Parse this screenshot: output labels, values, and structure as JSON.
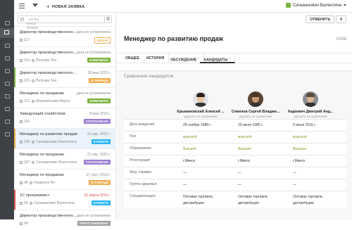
{
  "topbar": {
    "new_request": "НОВАЯ ЗАЯВКА",
    "user": "Сильванович Валентина"
  },
  "search": {
    "placeholder": "Быстрый поиск заявки"
  },
  "requests": [
    {
      "title": "Директор производственного...",
      "date": "дата не установлена",
      "num": "117",
      "person": "",
      "badge": "НОВАЯ",
      "badge_color": "outline",
      "bar": "",
      "date_red": false
    },
    {
      "title": "Директор производственного...",
      "date": "дата не установлена",
      "num": "116",
      "person": "Петрова Зоя",
      "badge": "ЗАВЕРШЕНА",
      "badge_color": "#7cb342",
      "bar": "",
      "date_red": false
    },
    {
      "title": "Директор производственного...",
      "date": "28 мая 2015 г.",
      "num": "115",
      "person": "Петрова Зоя",
      "badge": "В ОЧЕРЕДИ",
      "badge_color": "#f0ad4e",
      "bar": "#7cb342",
      "date_red": false
    },
    {
      "title": "Менеджер по продажам",
      "date": "дата не установлена",
      "num": "113",
      "person": "Шереметьева Марта",
      "badge": "ЗАВЕРШЕНА",
      "badge_color": "#7cb342",
      "bar": "",
      "date_red": false
    },
    {
      "title": "Заведующий хозяйством",
      "date": "8 мая 2015 г.",
      "num": "110",
      "person": "",
      "badge": "СОГЛАСОВАНА",
      "badge_color": "#9b7fd1",
      "bar": "",
      "date_red": false
    },
    {
      "title": "Менеджер по развитию продаж",
      "date": "21 апр. 2015 г.",
      "num": "108",
      "person": "Сильванович Валентина",
      "badge": "В РАБОТЕ",
      "badge_color": "#29b6f6",
      "bar": "#f0ad4e",
      "date_red": false
    },
    {
      "title": "Менеджер по продажам",
      "date": "21 апр. 2015 г.",
      "num": "107",
      "person": "Сильванович Валентина",
      "badge": "СОГЛАСОВАНА",
      "badge_color": "#9b7fd1",
      "bar": "",
      "date_red": false
    },
    {
      "title": "Менеджер по продажам",
      "date": "17 сент. 2013 г.",
      "num": "98",
      "person": "Азаренок Ян",
      "badge": "В ОЧЕРЕДИ",
      "badge_color": "#f0ad4e",
      "bar": "",
      "date_red": false
    },
    {
      "title": "1С программист",
      "date": "31 марта 2015 г.",
      "num": "96",
      "person": "Сильванович Валентина",
      "badge": "В РАБОТЕ",
      "badge_color": "#29b6f6",
      "bar": "#d9534f",
      "date_red": true
    },
    {
      "title": "Директор производственного...",
      "date": "дата не установлена",
      "num": "94",
      "person": "",
      "badge": "ПРИОСТАНОВЛЕНА",
      "badge_color": "#9e9e9e",
      "bar": "",
      "date_red": false
    }
  ],
  "detail": {
    "buttons": [
      "ОТМЕНИТЬ",
      "II"
    ],
    "title": "Менеджер по развитию продаж",
    "number": "#108",
    "tabs": [
      {
        "label": "ОБЩЕЕ",
        "count": ""
      },
      {
        "label": "ИСТОРИЯ",
        "count": ""
      },
      {
        "label": "ОБСУЖДЕНИЕ",
        "count": "2"
      },
      {
        "label": "КАНДИДАТЫ",
        "count": "5"
      }
    ],
    "compare_title": "Сравнение кандидатов",
    "candidates": [
      {
        "name": "Крыжановский Алексей ...",
        "status": "удалить из сравнения",
        "hair": "#2a1e16",
        "skin": "#e9c6a3",
        "bg": "#dfe3e6"
      },
      {
        "name": "Семенов Сергей Владим...",
        "status": "удалить из сравнения",
        "hair": "#4a3726",
        "skin": "#c99a72",
        "bg": "#5b4636"
      },
      {
        "name": "Хадкевич Дмитрий Анд...",
        "status": "удалить из сравнения",
        "hair": "#5a4a3a",
        "skin": "#dbb695",
        "bg": "#8a8d92"
      }
    ],
    "rows": [
      {
        "label": "Дата рождения",
        "values": [
          "28 ноября 1988 г.",
          "23 июля 1985 г.",
          "6 июня 2015 г."
        ],
        "link": false
      },
      {
        "label": "Пол",
        "values": [
          "мужской",
          "мужской",
          "мужской"
        ],
        "link": true
      },
      {
        "label": "Образование",
        "values": [
          "Высшее",
          "Высшее",
          "Высшее"
        ],
        "link": true
      },
      {
        "label": "Регистрация",
        "values": [
          "г.Минск",
          "г.Минск",
          "г.Минск"
        ],
        "link": false
      },
      {
        "label": "Мед. справка",
        "values": [
          "—",
          "—",
          "—"
        ],
        "link": false
      },
      {
        "label": "Группа здоровья",
        "values": [
          "—",
          "—",
          "—"
        ],
        "link": false
      },
      {
        "label": "Специализация",
        "values": [
          "Оптовая торговля, дистрибуция",
          "Оптовая торговля, дистрибуция",
          "Оптовая торговля, дистрибуция"
        ],
        "link": false
      }
    ]
  }
}
